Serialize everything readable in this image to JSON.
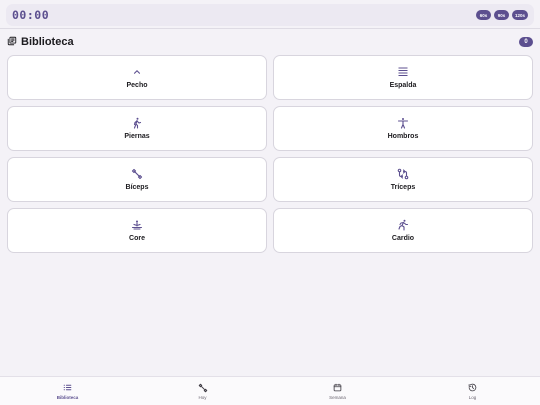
{
  "timer": {
    "display": "00:00",
    "presets": [
      "60s",
      "90s",
      "120s"
    ]
  },
  "library": {
    "title": "Biblioteca",
    "count": "0",
    "categories": [
      {
        "label": "Pecho",
        "icon": "chevron-up-icon"
      },
      {
        "label": "Espalda",
        "icon": "horizontal-lines-icon"
      },
      {
        "label": "Piernas",
        "icon": "walking-person-icon"
      },
      {
        "label": "Hombros",
        "icon": "person-arms-out-icon"
      },
      {
        "label": "Bíceps",
        "icon": "dumbbell-icon"
      },
      {
        "label": "Tríceps",
        "icon": "route-icon"
      },
      {
        "label": "Core",
        "icon": "rowing-icon"
      },
      {
        "label": "Cardio",
        "icon": "running-person-icon"
      }
    ]
  },
  "nav": {
    "items": [
      {
        "label": "Biblioteca",
        "icon": "list-icon",
        "active": true
      },
      {
        "label": "Hoy",
        "icon": "dumbbell-icon",
        "active": false
      },
      {
        "label": "Semana",
        "icon": "calendar-icon",
        "active": false
      },
      {
        "label": "Log",
        "icon": "history-icon",
        "active": false
      }
    ]
  },
  "colors": {
    "accent": "#5c4f8f",
    "background": "#f4f2f7",
    "card": "#ffffff"
  }
}
